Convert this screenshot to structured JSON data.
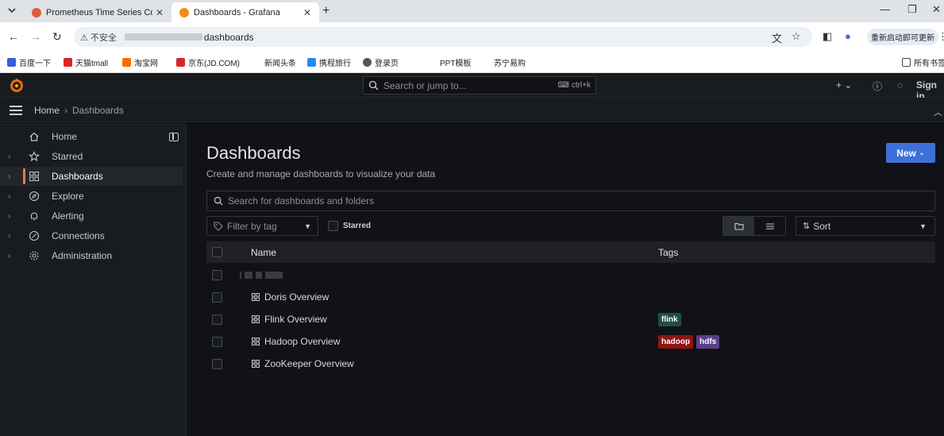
{
  "browser": {
    "tabs": [
      {
        "title": "Prometheus Time Series Coll",
        "active": false,
        "favicon_color": "#e05a3a"
      },
      {
        "title": "Dashboards - Grafana",
        "active": true,
        "favicon_color": "#f28b1c"
      }
    ],
    "address": {
      "insecure_label": "不安全",
      "url_suffix": "dashboards"
    },
    "update_button": "重新启动即可更新",
    "bookmarks": [
      {
        "label": "百度一下",
        "color": "#3b5bd9"
      },
      {
        "label": "天猫tmall",
        "color": "#e0222b"
      },
      {
        "label": "淘宝网",
        "color": "#ff6a00"
      },
      {
        "label": "京东(JD.COM)",
        "color": "#d9232a"
      },
      {
        "label": "新闻头条",
        "color": ""
      },
      {
        "label": "携程旅行",
        "color": "#2a8ce8"
      },
      {
        "label": "登录页",
        "color": "#555555"
      },
      {
        "label": "PPT模板",
        "color": ""
      },
      {
        "label": "苏宁易购",
        "color": ""
      }
    ],
    "bookmarks_folder": "所有书签"
  },
  "grafana": {
    "search_placeholder": "Search or jump to...",
    "search_shortcut": "ctrl+k",
    "sign_in": "Sign in",
    "breadcrumb": {
      "home": "Home",
      "current": "Dashboards"
    },
    "sidebar": [
      {
        "label": "Home",
        "icon": "home-icon",
        "expandable": false,
        "active": false
      },
      {
        "label": "Starred",
        "icon": "star-icon",
        "expandable": true,
        "active": false
      },
      {
        "label": "Dashboards",
        "icon": "apps-icon",
        "expandable": true,
        "active": true
      },
      {
        "label": "Explore",
        "icon": "compass-icon",
        "expandable": true,
        "active": false
      },
      {
        "label": "Alerting",
        "icon": "bell-icon",
        "expandable": true,
        "active": false
      },
      {
        "label": "Connections",
        "icon": "connections-icon",
        "expandable": true,
        "active": false
      },
      {
        "label": "Administration",
        "icon": "cog-icon",
        "expandable": true,
        "active": false
      }
    ],
    "page": {
      "title": "Dashboards",
      "subtitle": "Create and manage dashboards to visualize your data",
      "new_button": "New",
      "search_placeholder": "Search for dashboards and folders",
      "filter_by_tag": "Filter by tag",
      "starred_label": "Starred",
      "sort_label": "Sort",
      "columns": {
        "name": "Name",
        "tags": "Tags"
      },
      "rows": [
        {
          "name": "Doris Overview",
          "tags": []
        },
        {
          "name": "Flink Overview",
          "tags": [
            {
              "text": "flink",
              "color": "#1f4f3f"
            }
          ]
        },
        {
          "name": "Hadoop Overview",
          "tags": [
            {
              "text": "hadoop",
              "color": "#8f1414"
            },
            {
              "text": "hdfs",
              "color": "#5a3f86"
            }
          ]
        },
        {
          "name": "ZooKeeper Overview",
          "tags": []
        }
      ]
    },
    "accent": "#ff7733",
    "primary": "#3d71d9"
  }
}
